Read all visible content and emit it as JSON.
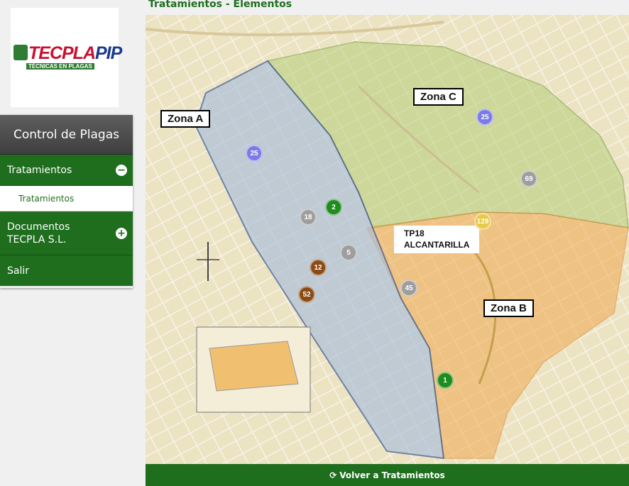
{
  "logo": {
    "brand": "TECPLA",
    "brand_suffix": "PIP",
    "tagline": "TÉCNICAS EN PLAGAS"
  },
  "sidebar": {
    "header": "Control de Plagas",
    "items": [
      {
        "label": "Tratamientos",
        "toggle": "−"
      },
      {
        "label": "Tratamientos"
      },
      {
        "label": "Documentos TECPLA S.L.",
        "toggle": "+"
      },
      {
        "label": "Salir"
      }
    ]
  },
  "page": {
    "title": "Tratamientos - Elementos"
  },
  "map": {
    "zones": [
      "Zona A",
      "Zona B",
      "Zona C"
    ],
    "tp_label_line1": "TP18",
    "tp_label_line2": "ALCANTARILLA",
    "markers": [
      "25",
      "25",
      "69",
      "2",
      "18",
      "129",
      "5",
      "12",
      "52",
      "45",
      "1"
    ],
    "colors": {
      "purple": "#7b7be8",
      "gray": "#9e9e9e",
      "green": "#1e8c1e",
      "brown": "#8a4b14",
      "yellow": "#e8c94a"
    }
  },
  "footer": {
    "back_label": "Volver a Tratamientos"
  }
}
